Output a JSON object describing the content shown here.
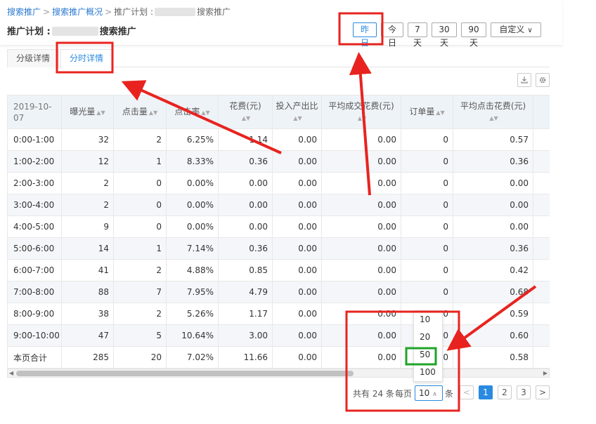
{
  "breadcrumb": {
    "item1": "搜索推广",
    "item2": "搜索推广概况",
    "item3_prefix": "推广计划 :",
    "item3_suffix": "搜索推广",
    "sep": ">"
  },
  "plan_title": {
    "prefix": "推广计划 :",
    "suffix": "搜索推广"
  },
  "date_buttons": {
    "yesterday": "昨日",
    "today": "今日",
    "d7": "7天",
    "d30": "30天",
    "d90": "90天",
    "custom": "自定义"
  },
  "tabs": {
    "level_detail": "分级详情",
    "hourly_detail": "分时详情"
  },
  "table": {
    "columns": [
      "2019-10-07",
      "曝光量",
      "点击量",
      "点击率",
      "花费(元)",
      "投入产出比",
      "平均成交花费(元)",
      "订单量",
      "平均点击花费(元)"
    ],
    "rows": [
      [
        "0:00-1:00",
        "32",
        "2",
        "6.25%",
        "1.14",
        "0.00",
        "0.00",
        "0",
        "0.57"
      ],
      [
        "1:00-2:00",
        "12",
        "1",
        "8.33%",
        "0.36",
        "0.00",
        "0.00",
        "0",
        "0.36"
      ],
      [
        "2:00-3:00",
        "2",
        "0",
        "0.00%",
        "0.00",
        "0.00",
        "0.00",
        "0",
        "0.00"
      ],
      [
        "3:00-4:00",
        "2",
        "0",
        "0.00%",
        "0.00",
        "0.00",
        "0.00",
        "0",
        "0.00"
      ],
      [
        "4:00-5:00",
        "9",
        "0",
        "0.00%",
        "0.00",
        "0.00",
        "0.00",
        "0",
        "0.00"
      ],
      [
        "5:00-6:00",
        "14",
        "1",
        "7.14%",
        "0.36",
        "0.00",
        "0.00",
        "0",
        "0.36"
      ],
      [
        "6:00-7:00",
        "41",
        "2",
        "4.88%",
        "0.85",
        "0.00",
        "0.00",
        "0",
        "0.42"
      ],
      [
        "7:00-8:00",
        "88",
        "7",
        "7.95%",
        "4.79",
        "0.00",
        "0.00",
        "0",
        "0.68"
      ],
      [
        "8:00-9:00",
        "38",
        "2",
        "5.26%",
        "1.17",
        "0.00",
        "0.00",
        "0",
        "0.59"
      ],
      [
        "9:00-10:00",
        "47",
        "5",
        "10.64%",
        "3.00",
        "0.00",
        "0.00",
        "0",
        "0.60"
      ],
      [
        "本页合计",
        "285",
        "20",
        "7.02%",
        "11.66",
        "0.00",
        "0.00",
        "0",
        "0.58"
      ]
    ]
  },
  "pagination": {
    "total_text": "共有 24 条",
    "per_page_label": "每页",
    "per_page_value": "10",
    "unit": "条",
    "pages": [
      "1",
      "2",
      "3"
    ],
    "current_page": "1",
    "prev": "<",
    "next": ">"
  },
  "page_size_options": [
    "10",
    "20",
    "50",
    "100"
  ],
  "icons": {
    "export": "download-icon",
    "settings": "gear-icon",
    "sort": "sort-icon",
    "chevron": "chevron-down-icon"
  },
  "colors": {
    "accent": "#2a8ae0",
    "annotation_red": "#e8231f",
    "annotation_green": "#1fa32a",
    "header_bg": "#eef3f8"
  }
}
